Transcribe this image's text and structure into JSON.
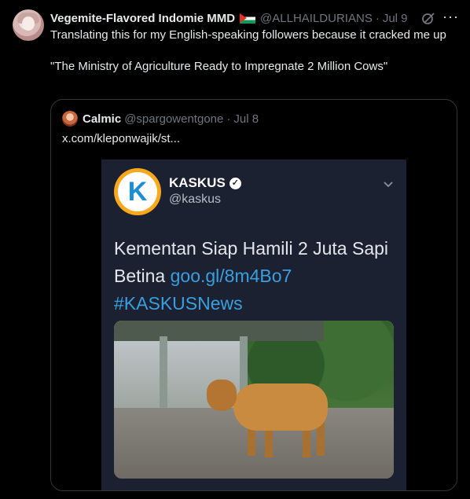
{
  "post": {
    "author_name": "Vegemite-Flavored Indomie MMD",
    "author_handle": "@ALLHAILDURIANS",
    "separator": "·",
    "date": "Jul 9",
    "more_label": "···",
    "text_line1": "Translating this for my English-speaking followers because it cracked me up",
    "text_line2": "\"The Ministry of Agriculture Ready to Impregnate 2 Million Cows\""
  },
  "quote": {
    "author_name": "Calmic",
    "author_handle": "@spargowentgone",
    "separator": "·",
    "date": "Jul 8",
    "text": "x.com/kleponwajik/st..."
  },
  "card": {
    "logo_letter": "K",
    "name": "KASKUS",
    "handle": "@kaskus",
    "headline": "Kementan Siap Hamili 2 Juta Sapi Betina",
    "link": "goo.gl/8m4Bo7",
    "hashtag": "#KASKUSNews"
  },
  "icons": {
    "flag": "palestine-flag-icon",
    "grok": "grok-icon",
    "more": "more-icon",
    "verified": "verified-icon",
    "chevron": "chevron-down-icon"
  },
  "colors": {
    "background": "#000000",
    "text": "#e7e9ea",
    "muted": "#71767b",
    "link": "#3a9fe0",
    "kaskus_orange": "#f7a81b",
    "kaskus_blue": "#1a8fd6"
  }
}
